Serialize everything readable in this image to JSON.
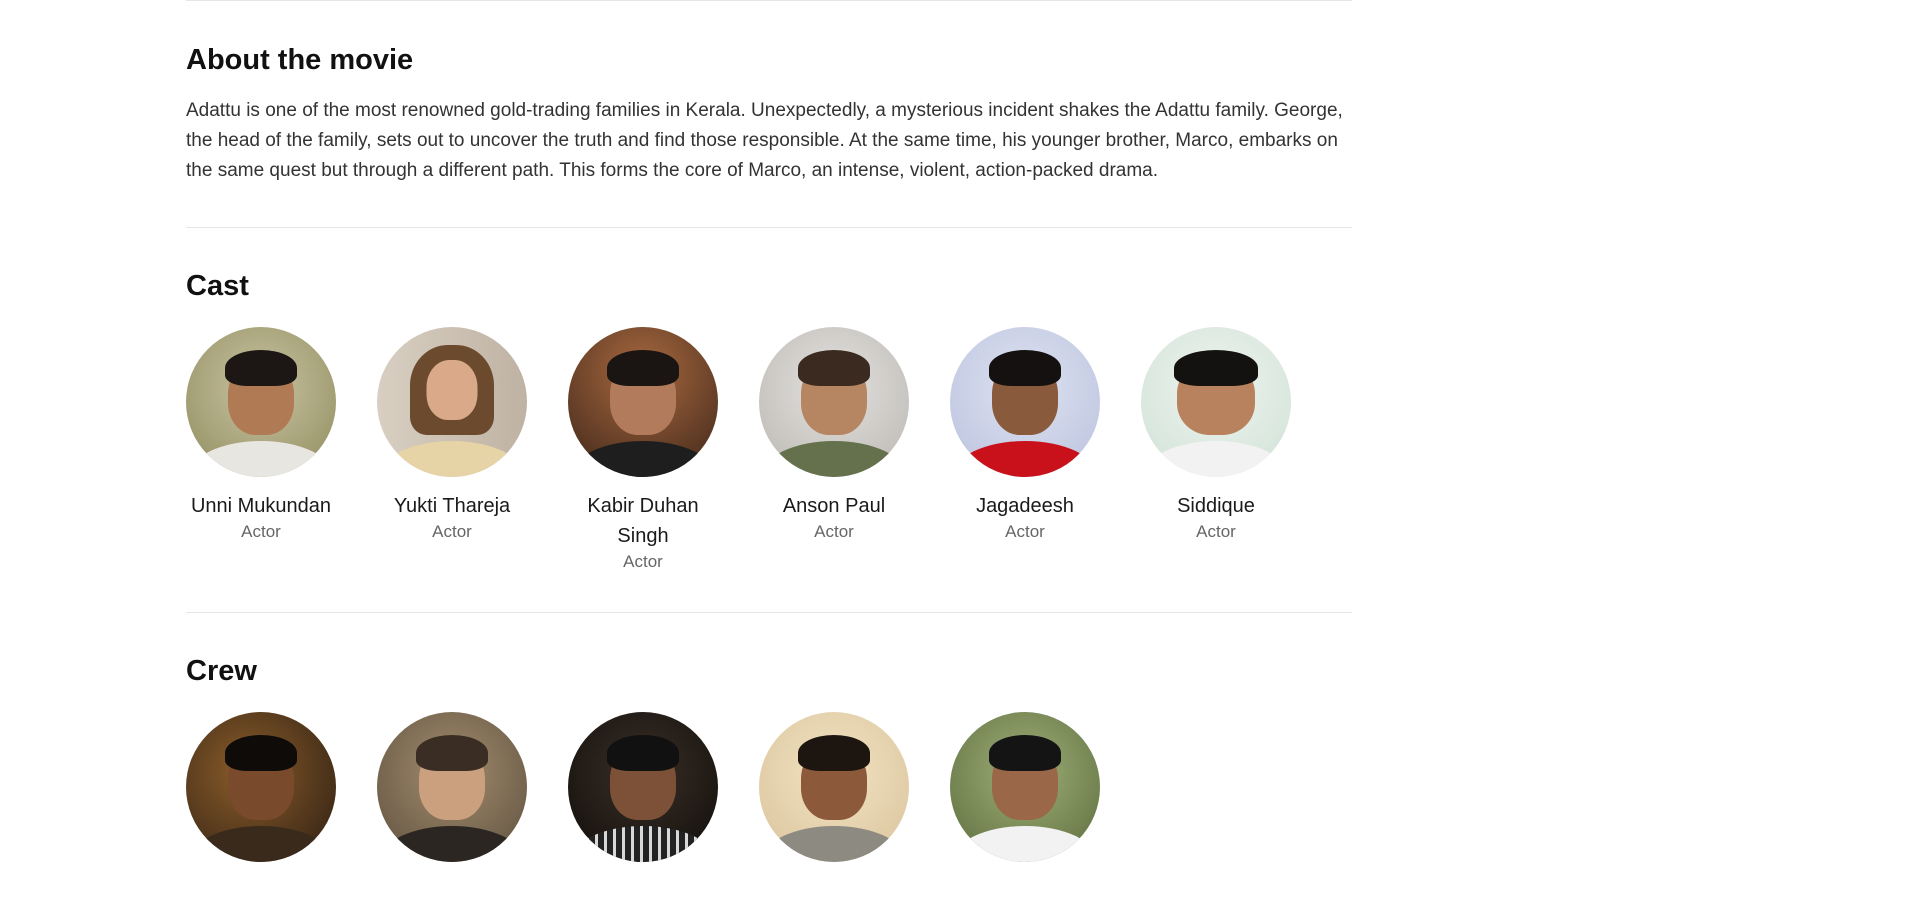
{
  "about": {
    "title": "About the movie",
    "text": "Adattu is one of the most renowned gold-trading families in Kerala. Unexpectedly, a mysterious incident shakes the Adattu family. George, the head of the family, sets out to uncover the truth and find those responsible. At the same time, his younger brother, Marco, embarks on the same quest but through a different path. This forms the core of Marco, an intense, violent, action-packed drama."
  },
  "cast": {
    "title": "Cast",
    "members": [
      {
        "name": "Unni Mukundan",
        "role": "Actor"
      },
      {
        "name": "Yukti Thareja",
        "role": "Actor"
      },
      {
        "name": "Kabir Duhan Singh",
        "role": "Actor"
      },
      {
        "name": "Anson Paul",
        "role": "Actor"
      },
      {
        "name": "Jagadeesh",
        "role": "Actor"
      },
      {
        "name": "Siddique",
        "role": "Actor"
      }
    ]
  },
  "crew": {
    "title": "Crew"
  }
}
